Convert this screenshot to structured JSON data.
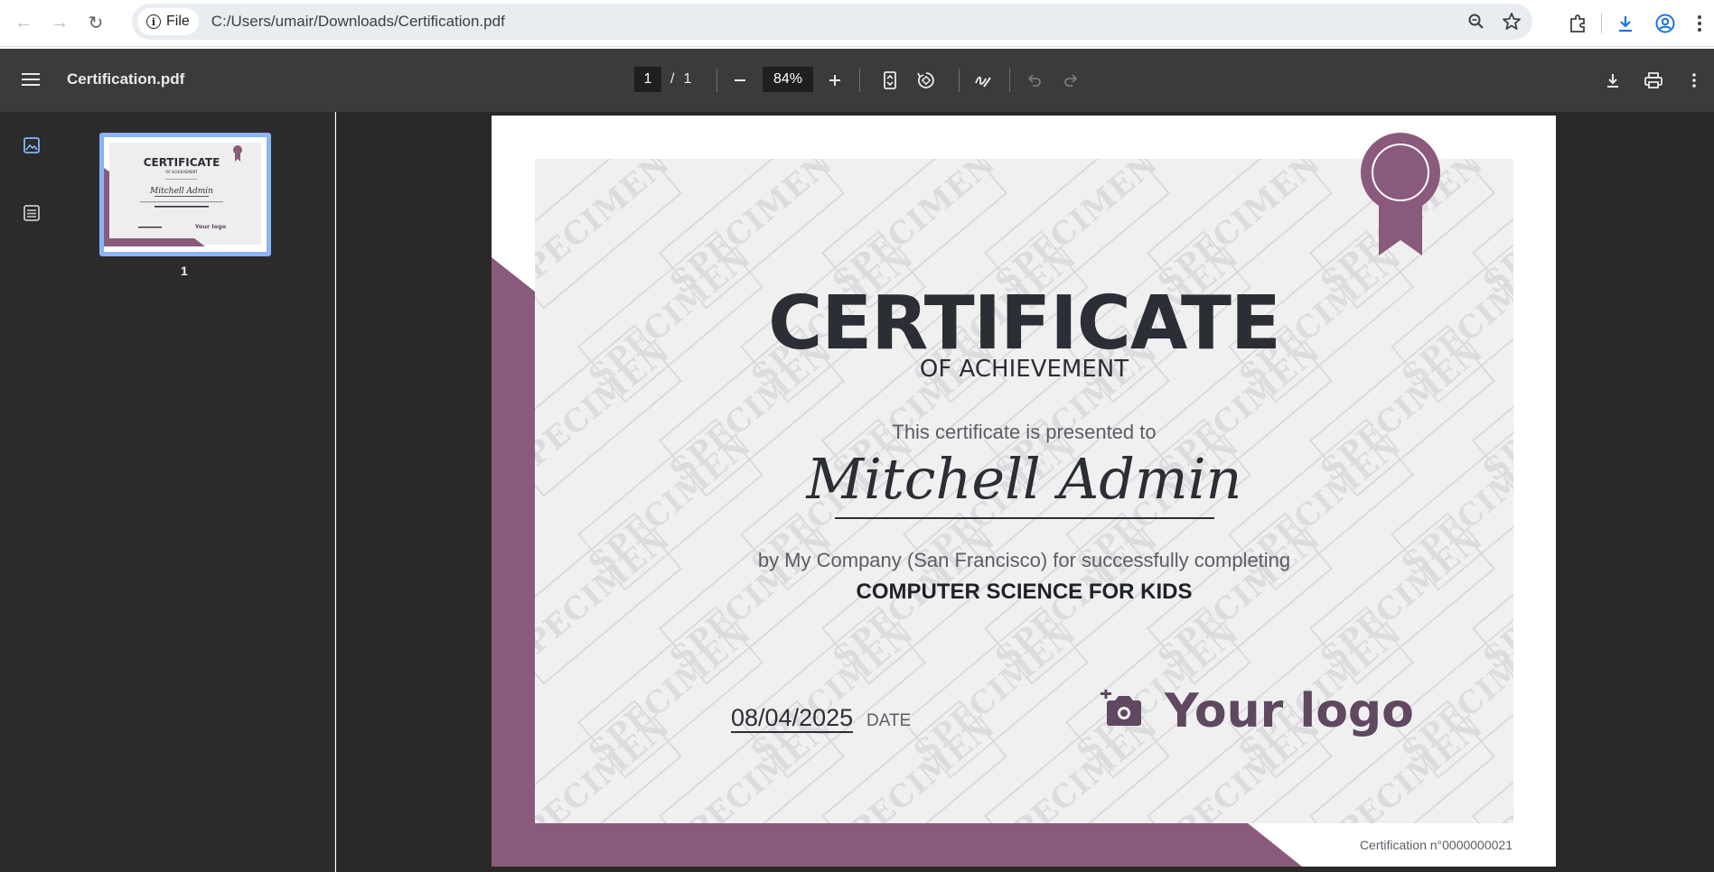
{
  "browser": {
    "site_chip": "File",
    "url": "C:/Users/umair/Downloads/Certification.pdf"
  },
  "pdf_toolbar": {
    "title": "Certification.pdf",
    "current_page": "1",
    "page_separator": "/",
    "total_pages": "1",
    "zoom": "84%"
  },
  "sidebar": {
    "thumbnail_page_number": "1",
    "thumbnail": {
      "title": "CERTIFICATE",
      "subtitle": "OF ACHIEVEMENT",
      "name": "Mitchell Admin",
      "logo": "Your logo"
    }
  },
  "certificate": {
    "title": "CERTIFICATE",
    "subtitle": "OF ACHIEVEMENT",
    "presented_to": "This certificate is presented to",
    "recipient": "Mitchell Admin",
    "by_line": "by My Company (San Francisco) for successfully completing",
    "course": "COMPUTER SCIENCE FOR KIDS",
    "date_value": "08/04/2025",
    "date_label": "DATE",
    "logo_text": "Your logo",
    "certificate_number": "Certification n°0000000021",
    "watermark": "SPECIMEN"
  },
  "colors": {
    "accent_purple": "#8a5a7c",
    "toolbar_bg": "#3b3b3b",
    "viewer_bg": "#282828",
    "thumb_highlight": "#8ab4f8"
  }
}
